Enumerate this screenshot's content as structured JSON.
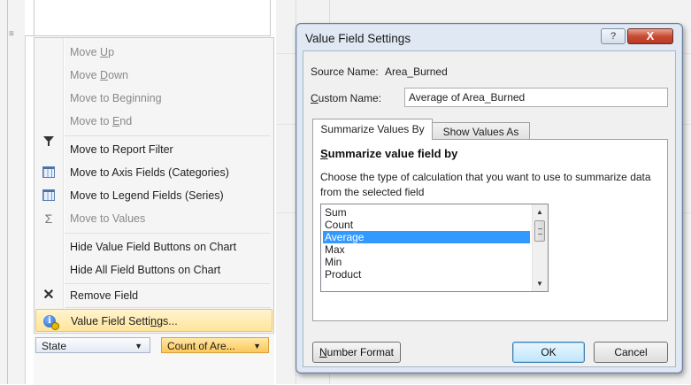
{
  "context_menu": {
    "items": [
      {
        "label": "Move Up",
        "enabled": false,
        "icon": ""
      },
      {
        "label": "Move Down",
        "enabled": false,
        "icon": ""
      },
      {
        "label": "Move to Beginning",
        "enabled": false,
        "icon": ""
      },
      {
        "label": "Move to End",
        "enabled": false,
        "icon": ""
      },
      {
        "label": "Move to Report Filter",
        "enabled": true,
        "icon": "filter-funnel-icon"
      },
      {
        "label": "Move to Axis Fields (Categories)",
        "enabled": true,
        "icon": "axis-fields-grid-icon"
      },
      {
        "label": "Move to Legend Fields (Series)",
        "enabled": true,
        "icon": "legend-fields-grid-icon"
      },
      {
        "label": "Move to Values",
        "enabled": false,
        "icon": "sigma-icon"
      },
      {
        "label": "Hide Value Field Buttons on Chart",
        "enabled": true,
        "icon": ""
      },
      {
        "label": "Hide All Field Buttons on Chart",
        "enabled": true,
        "icon": ""
      },
      {
        "label": "Remove Field",
        "enabled": true,
        "icon": "remove-x-icon"
      },
      {
        "label": "Value Field Settings...",
        "enabled": true,
        "icon": "value-field-settings-icon",
        "highlighted": true
      }
    ]
  },
  "field_buttons": {
    "state": "State",
    "count": "Count of Are..."
  },
  "dialog": {
    "title": "Value Field Settings",
    "help_glyph": "?",
    "close_glyph": "X",
    "source_name_label": "Source Name:",
    "source_name_value": "Area_Burned",
    "custom_name_label": "Custom Name:",
    "custom_name_value": "Average of Area_Burned",
    "tabs": [
      "Summarize Values By",
      "Show Values As"
    ],
    "active_tab": 0,
    "panel_heading": "Summarize value field by",
    "panel_description": "Choose the type of calculation that you want to use to summarize data from the selected field",
    "functions": [
      "Sum",
      "Count",
      "Average",
      "Max",
      "Min",
      "Product"
    ],
    "selected_function": "Average",
    "buttons": {
      "number_format": "Number Format",
      "ok": "OK",
      "cancel": "Cancel"
    }
  }
}
